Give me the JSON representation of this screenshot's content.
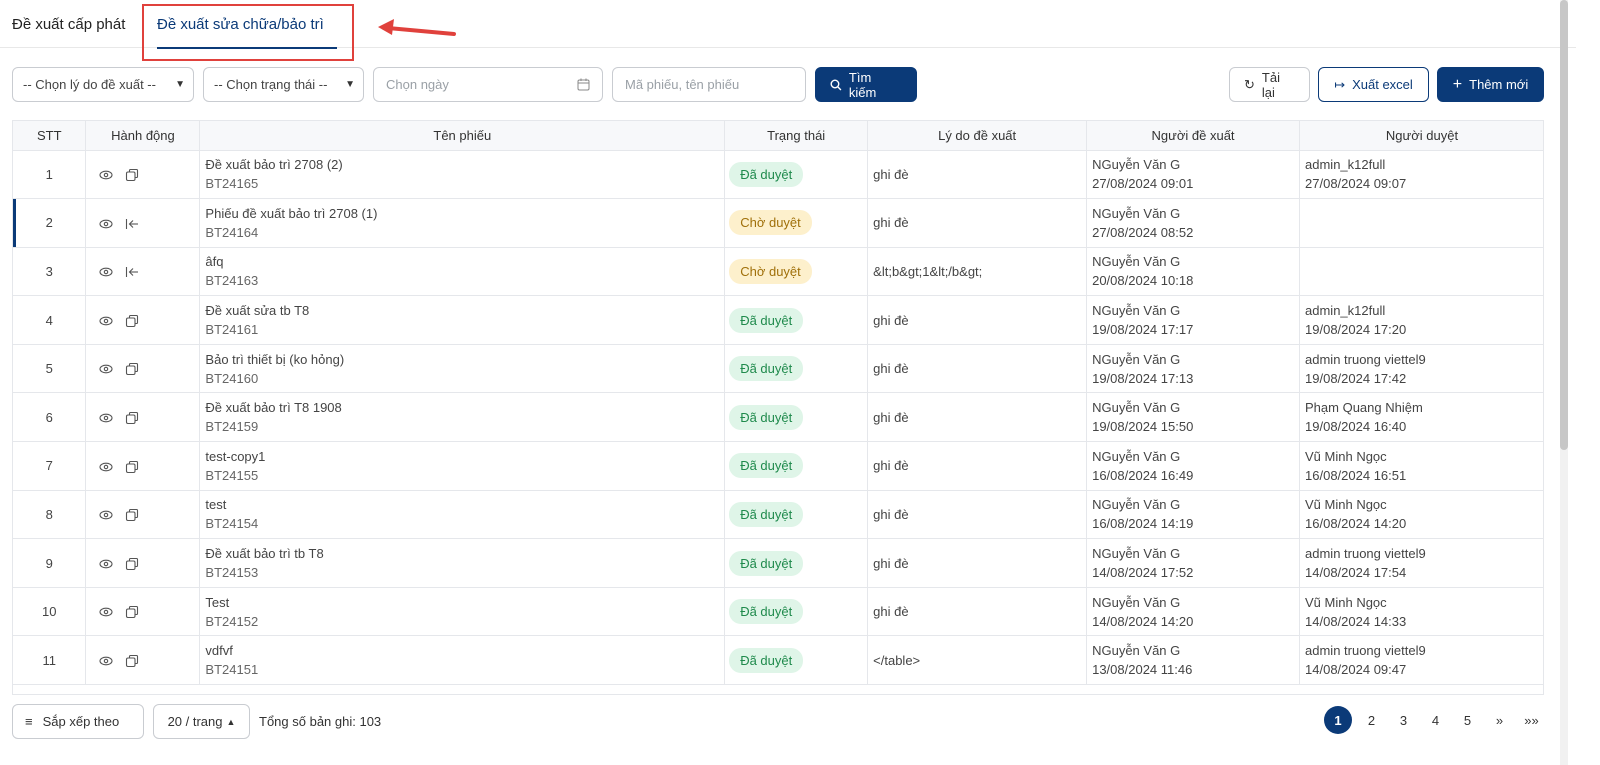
{
  "tabs": [
    {
      "label": "Đề xuất cấp phát"
    },
    {
      "label": "Đề xuất sửa chữa/bảo trì",
      "active": true
    }
  ],
  "filters": {
    "reason_select": "-- Chọn lý do đề xuất --",
    "status_select": "-- Chọn trạng thái --",
    "date_placeholder": "Chọn ngày",
    "search_placeholder": "Mã phiếu, tên phiếu",
    "search_button": "Tìm kiếm",
    "reload_button": "Tải lại",
    "export_button": "Xuất excel",
    "add_button": "Thêm mới"
  },
  "table": {
    "columns": [
      "STT",
      "Hành động",
      "Tên phiếu",
      "Trạng thái",
      "Lý do đề xuất",
      "Người đề xuất",
      "Người duyệt"
    ],
    "rows": [
      {
        "stt": "1",
        "icon2": "copy-icon",
        "name": "Đề xuất bảo trì 2708 (2)",
        "code": "BT24165",
        "status": "Đã duyệt",
        "reason": "ghi đè",
        "proposer": "NGuyễn Văn G",
        "proposer_time": "27/08/2024 09:01",
        "approver": "admin_k12full",
        "approver_time": "27/08/2024 09:07"
      },
      {
        "stt": "2",
        "icon2": "revert-icon",
        "name": "Phiếu đề xuất bảo trì 2708 (1)",
        "code": "BT24164",
        "status": "Chờ duyệt",
        "reason": "ghi đè",
        "proposer": "NGuyễn Văn G",
        "proposer_time": "27/08/2024 08:52",
        "approver": "",
        "approver_time": ""
      },
      {
        "stt": "3",
        "icon2": "revert-icon",
        "name": "âfq",
        "code": "BT24163",
        "status": "Chờ duyệt",
        "reason": "&lt;b&gt;1&lt;/b&gt;",
        "proposer": "NGuyễn Văn G",
        "proposer_time": "20/08/2024 10:18",
        "approver": "",
        "approver_time": ""
      },
      {
        "stt": "4",
        "icon2": "copy-icon",
        "name": "Đề xuất sửa tb T8",
        "code": "BT24161",
        "status": "Đã duyệt",
        "reason": "ghi đè",
        "proposer": "NGuyễn Văn G",
        "proposer_time": "19/08/2024 17:17",
        "approver": "admin_k12full",
        "approver_time": "19/08/2024 17:20"
      },
      {
        "stt": "5",
        "icon2": "copy-icon",
        "name": "Bảo trì thiết bị (ko hỏng)",
        "code": "BT24160",
        "status": "Đã duyệt",
        "reason": "ghi đè",
        "proposer": "NGuyễn Văn G",
        "proposer_time": "19/08/2024 17:13",
        "approver": "admin truong viettel9",
        "approver_time": "19/08/2024 17:42"
      },
      {
        "stt": "6",
        "icon2": "copy-icon",
        "name": "Đề xuất bảo trì T8 1908",
        "code": "BT24159",
        "status": "Đã duyệt",
        "reason": "ghi đè",
        "proposer": "NGuyễn Văn G",
        "proposer_time": "19/08/2024 15:50",
        "approver": "Phạm Quang Nhiệm",
        "approver_time": "19/08/2024 16:40"
      },
      {
        "stt": "7",
        "icon2": "copy-icon",
        "name": "test-copy1",
        "code": "BT24155",
        "status": "Đã duyệt",
        "reason": "ghi đè",
        "proposer": "NGuyễn Văn G",
        "proposer_time": "16/08/2024 16:49",
        "approver": "Vũ Minh Ngọc",
        "approver_time": "16/08/2024 16:51"
      },
      {
        "stt": "8",
        "icon2": "copy-icon",
        "name": "test",
        "code": "BT24154",
        "status": "Đã duyệt",
        "reason": "ghi đè",
        "proposer": "NGuyễn Văn G",
        "proposer_time": "16/08/2024 14:19",
        "approver": "Vũ Minh Ngọc",
        "approver_time": "16/08/2024 14:20"
      },
      {
        "stt": "9",
        "icon2": "copy-icon",
        "name": "Đề xuất bảo trì tb T8",
        "code": "BT24153",
        "status": "Đã duyệt",
        "reason": "ghi đè",
        "proposer": "NGuyễn Văn G",
        "proposer_time": "14/08/2024 17:52",
        "approver": "admin truong viettel9",
        "approver_time": "14/08/2024 17:54"
      },
      {
        "stt": "10",
        "icon2": "copy-icon",
        "name": "Test",
        "code": "BT24152",
        "status": "Đã duyệt",
        "reason": "ghi đè",
        "proposer": "NGuyễn Văn G",
        "proposer_time": "14/08/2024 14:20",
        "approver": "Vũ Minh Ngọc",
        "approver_time": "14/08/2024 14:33"
      },
      {
        "stt": "11",
        "icon2": "copy-icon",
        "name": "vdfvf",
        "code": "BT24151",
        "status": "Đã duyệt",
        "reason": "</table>",
        "proposer": "NGuyễn Văn G",
        "proposer_time": "13/08/2024 11:46",
        "approver": "admin truong viettel9",
        "approver_time": "14/08/2024 09:47"
      }
    ]
  },
  "footer": {
    "sort_label": "Sắp xếp theo",
    "per_page": "20 / trang",
    "total": "Tổng số bản ghi: 103",
    "pages": [
      "1",
      "2",
      "3",
      "4",
      "5",
      "»",
      "»»"
    ]
  },
  "colors": {
    "primary": "#0b3a78",
    "approved_bg": "#dff5e8",
    "approved_text": "#1f8a4c",
    "pending_bg": "#fdf0cc",
    "pending_text": "#a0700a",
    "highlight": "#e0413c"
  }
}
